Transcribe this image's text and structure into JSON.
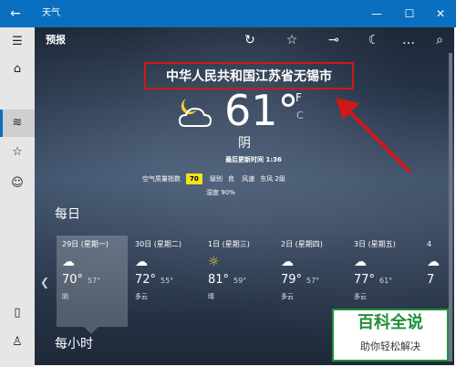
{
  "titlebar": {
    "title": "天气",
    "back_glyph": "←",
    "min": "—",
    "max": "☐",
    "close": "✕"
  },
  "nav": {
    "items": [
      {
        "name": "hamburger-menu-icon",
        "glyph": "☰"
      },
      {
        "name": "home-icon",
        "glyph": "⌂"
      },
      {
        "name": "historical-weather-icon",
        "glyph": "≋"
      },
      {
        "name": "favorites-icon",
        "glyph": "☆"
      },
      {
        "name": "feedback-icon",
        "glyph": "☺"
      },
      {
        "name": "phone-icon",
        "glyph": "▯"
      },
      {
        "name": "account-icon",
        "glyph": "♙"
      }
    ]
  },
  "toolbar": {
    "page_title": "预报",
    "icons": [
      {
        "name": "refresh-icon",
        "glyph": "↻"
      },
      {
        "name": "favorite-star-icon",
        "glyph": "☆"
      },
      {
        "name": "pin-icon",
        "glyph": "⊸"
      },
      {
        "name": "theme-moon-icon",
        "glyph": "☾"
      },
      {
        "name": "more-icon",
        "glyph": "…"
      },
      {
        "name": "search-icon",
        "glyph": "⌕"
      }
    ]
  },
  "current": {
    "location": "中华人民共和国江苏省无锡市",
    "temperature": "61°",
    "unit_f": "F",
    "unit_c": "C",
    "condition": "阴",
    "updated": "最后更新时间 1:36",
    "aqi_label": "空气质量指数",
    "aqi_value": "70",
    "level_label": "级别",
    "level_value": "良",
    "wind_label": "风速",
    "wind_value": "东风 2级",
    "humidity_label": "湿度",
    "humidity_value": "90%"
  },
  "daily": {
    "heading": "每日",
    "days": [
      {
        "date": "29日 (星期一)",
        "icon": "☁",
        "high": "70°",
        "low": "57°",
        "desc": "阴"
      },
      {
        "date": "30日 (星期二)",
        "icon": "☁",
        "high": "72°",
        "low": "55°",
        "desc": "多云"
      },
      {
        "date": "1日 (星期三)",
        "icon": "☼",
        "high": "81°",
        "low": "59°",
        "desc": "晴"
      },
      {
        "date": "2日 (星期四)",
        "icon": "☁",
        "high": "79°",
        "low": "57°",
        "desc": "多云"
      },
      {
        "date": "3日 (星期五)",
        "icon": "☁",
        "high": "77°",
        "low": "61°",
        "desc": "多云"
      },
      {
        "date": "4",
        "icon": "☁",
        "high": "7",
        "low": "",
        "desc": ""
      }
    ]
  },
  "hourly": {
    "heading": "每小时"
  },
  "watermark": {
    "title": "百科全说",
    "subtitle": "助你轻松解决"
  },
  "colors": {
    "titlebar": "#0a6fbf",
    "aqi_badge": "#f2e21b",
    "annotation": "#d01818",
    "watermark_green": "#1f8f3a"
  }
}
